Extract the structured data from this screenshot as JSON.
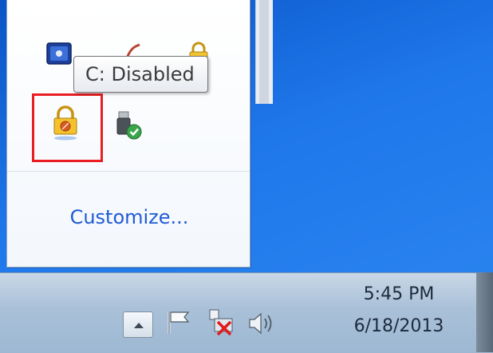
{
  "tooltip": {
    "text": "C: Disabled"
  },
  "tray_popup": {
    "customize_label": "Customize...",
    "icons": [
      {
        "name": "blue-app-icon"
      },
      {
        "name": "red-stroke-icon"
      },
      {
        "name": "yellow-lock-small-icon"
      },
      {
        "name": "encryption-lock-icon",
        "status": "highlighted"
      },
      {
        "name": "usb-safe-removal-icon"
      }
    ]
  },
  "taskbar": {
    "icons": [
      "show-hidden-icons-arrow",
      "action-center-flag-icon",
      "network-disconnected-icon",
      "volume-icon"
    ],
    "clock": {
      "time": "5:45 PM",
      "date": "6/18/2013"
    }
  },
  "colors": {
    "desktop": "#1c70e6",
    "highlight_box": "#ea1d22",
    "link": "#1f5bd6",
    "taskbar": "#a9c0d8"
  }
}
